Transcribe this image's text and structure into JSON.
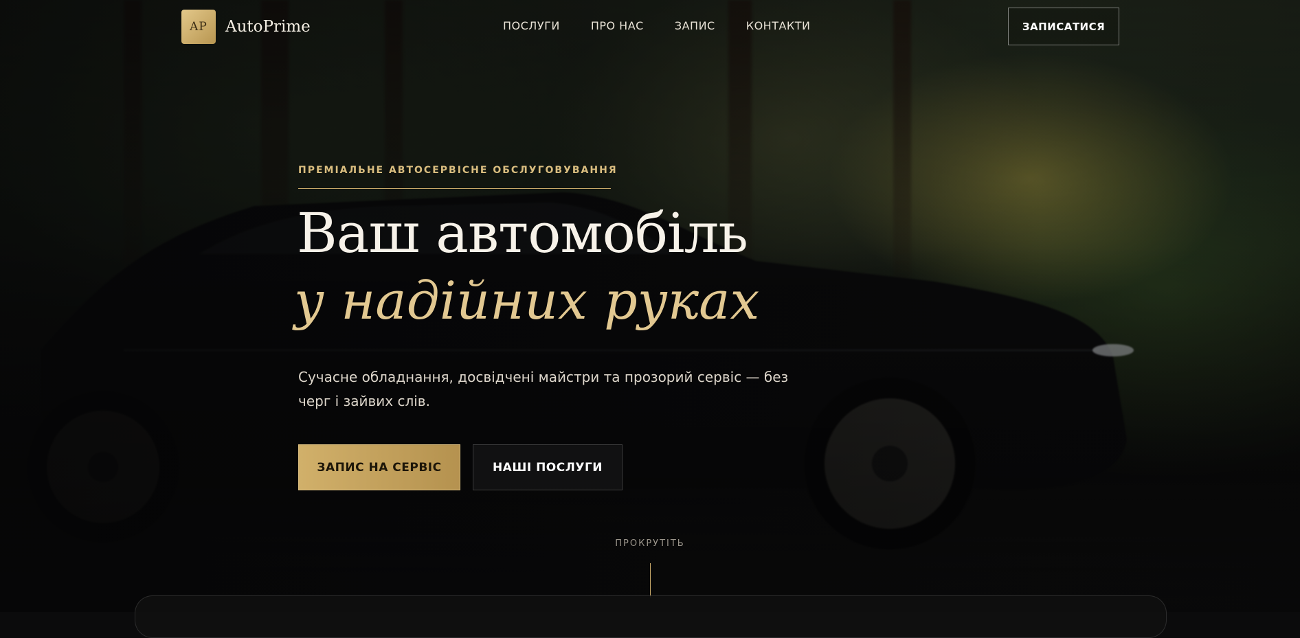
{
  "brand": {
    "badge": "AP",
    "name": "AutoPrime"
  },
  "nav": {
    "items": [
      "ПОСЛУГИ",
      "ПРО НАС",
      "ЗАПИС",
      "КОНТАКТИ"
    ]
  },
  "header": {
    "cta_label": "ЗАПИСАТИСЯ"
  },
  "hero": {
    "eyebrow": "ПРЕМІАЛЬНЕ АВТОСЕРВІСНЕ ОБСЛУГОВУВАННЯ",
    "title_line1": "Ваш автомобіль",
    "title_line2": "у надійних руках",
    "subtitle": "Сучасне обладнання, досвідчені майстри та прозорий сервіс — без черг і зайвих слів.",
    "primary_button": "ЗАПИС НА СЕРВІС",
    "secondary_button": "НАШІ ПОСЛУГИ",
    "scroll_label": "ПРОКРУТІТЬ"
  },
  "colors": {
    "accent_gold": "#d1b06a",
    "background": "#0b0b0c"
  }
}
